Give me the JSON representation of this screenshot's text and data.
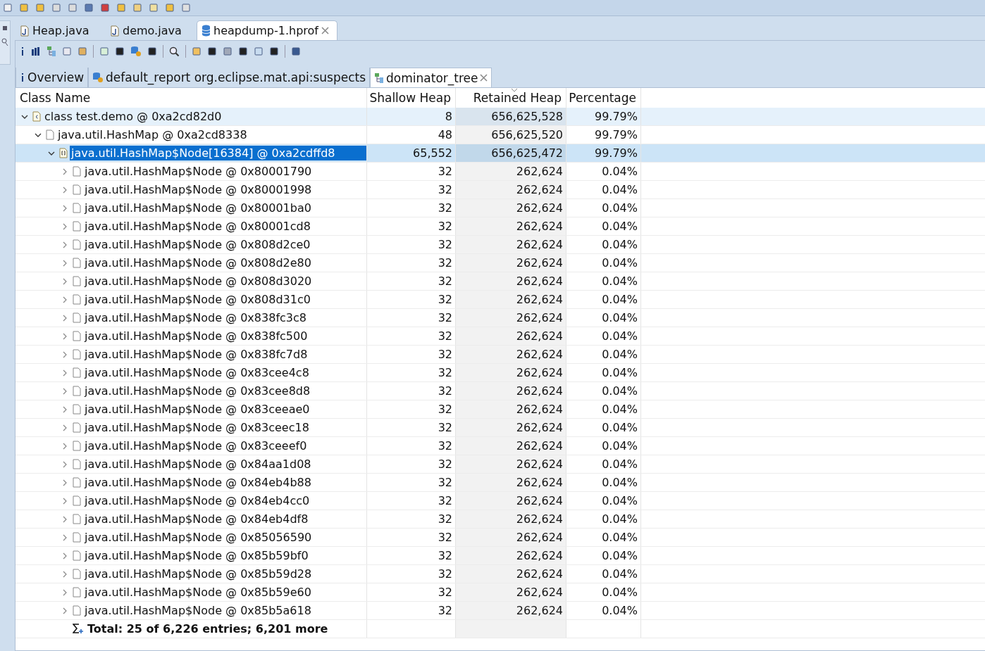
{
  "editor_tabs": [
    {
      "label": "Heap.java",
      "kind": "java",
      "selected": false,
      "closable": false
    },
    {
      "label": "demo.java",
      "kind": "java",
      "selected": false,
      "closable": false
    },
    {
      "label": "heapdump-1.hprof",
      "kind": "heap",
      "selected": true,
      "closable": true
    }
  ],
  "view_tabs": [
    {
      "label": "Overview",
      "kind": "info",
      "selected": false,
      "closable": false
    },
    {
      "label": "default_report  org.eclipse.mat.api:suspects",
      "kind": "report",
      "selected": false,
      "closable": false
    },
    {
      "label": "dominator_tree",
      "kind": "tree",
      "selected": true,
      "closable": true
    }
  ],
  "table": {
    "columns": [
      {
        "label": "Class Name",
        "sorted": false
      },
      {
        "label": "Shallow Heap",
        "sorted": false
      },
      {
        "label": "Retained Heap",
        "sorted": true
      },
      {
        "label": "Percentage",
        "sorted": false
      }
    ],
    "rows": [
      {
        "name": "class test.demo @ 0xa2cd82d0",
        "kind": "class",
        "shallow": "8",
        "retained": "656,625,528",
        "percentage": "99.79%",
        "expanded": true,
        "selected": false,
        "hovered": true,
        "children": [
          {
            "name": "java.util.HashMap @ 0xa2cd8338",
            "kind": "object",
            "shallow": "48",
            "retained": "656,625,520",
            "percentage": "99.79%",
            "expanded": true,
            "selected": false,
            "children": [
              {
                "name": "java.util.HashMap$Node[16384] @ 0xa2cdffd8",
                "kind": "array",
                "shallow": "65,552",
                "retained": "656,625,472",
                "percentage": "99.79%",
                "expanded": true,
                "selected": true,
                "children": [
                  {
                    "name": "java.util.HashMap$Node @ 0x80001790",
                    "kind": "object",
                    "shallow": "32",
                    "retained": "262,624",
                    "percentage": "0.04%",
                    "expanded": false,
                    "selected": false
                  },
                  {
                    "name": "java.util.HashMap$Node @ 0x80001998",
                    "kind": "object",
                    "shallow": "32",
                    "retained": "262,624",
                    "percentage": "0.04%",
                    "expanded": false,
                    "selected": false
                  },
                  {
                    "name": "java.util.HashMap$Node @ 0x80001ba0",
                    "kind": "object",
                    "shallow": "32",
                    "retained": "262,624",
                    "percentage": "0.04%",
                    "expanded": false,
                    "selected": false
                  },
                  {
                    "name": "java.util.HashMap$Node @ 0x80001cd8",
                    "kind": "object",
                    "shallow": "32",
                    "retained": "262,624",
                    "percentage": "0.04%",
                    "expanded": false,
                    "selected": false
                  },
                  {
                    "name": "java.util.HashMap$Node @ 0x808d2ce0",
                    "kind": "object",
                    "shallow": "32",
                    "retained": "262,624",
                    "percentage": "0.04%",
                    "expanded": false,
                    "selected": false
                  },
                  {
                    "name": "java.util.HashMap$Node @ 0x808d2e80",
                    "kind": "object",
                    "shallow": "32",
                    "retained": "262,624",
                    "percentage": "0.04%",
                    "expanded": false,
                    "selected": false
                  },
                  {
                    "name": "java.util.HashMap$Node @ 0x808d3020",
                    "kind": "object",
                    "shallow": "32",
                    "retained": "262,624",
                    "percentage": "0.04%",
                    "expanded": false,
                    "selected": false
                  },
                  {
                    "name": "java.util.HashMap$Node @ 0x808d31c0",
                    "kind": "object",
                    "shallow": "32",
                    "retained": "262,624",
                    "percentage": "0.04%",
                    "expanded": false,
                    "selected": false
                  },
                  {
                    "name": "java.util.HashMap$Node @ 0x838fc3c8",
                    "kind": "object",
                    "shallow": "32",
                    "retained": "262,624",
                    "percentage": "0.04%",
                    "expanded": false,
                    "selected": false
                  },
                  {
                    "name": "java.util.HashMap$Node @ 0x838fc500",
                    "kind": "object",
                    "shallow": "32",
                    "retained": "262,624",
                    "percentage": "0.04%",
                    "expanded": false,
                    "selected": false
                  },
                  {
                    "name": "java.util.HashMap$Node @ 0x838fc7d8",
                    "kind": "object",
                    "shallow": "32",
                    "retained": "262,624",
                    "percentage": "0.04%",
                    "expanded": false,
                    "selected": false
                  },
                  {
                    "name": "java.util.HashMap$Node @ 0x83cee4c8",
                    "kind": "object",
                    "shallow": "32",
                    "retained": "262,624",
                    "percentage": "0.04%",
                    "expanded": false,
                    "selected": false
                  },
                  {
                    "name": "java.util.HashMap$Node @ 0x83cee8d8",
                    "kind": "object",
                    "shallow": "32",
                    "retained": "262,624",
                    "percentage": "0.04%",
                    "expanded": false,
                    "selected": false
                  },
                  {
                    "name": "java.util.HashMap$Node @ 0x83ceeae0",
                    "kind": "object",
                    "shallow": "32",
                    "retained": "262,624",
                    "percentage": "0.04%",
                    "expanded": false,
                    "selected": false
                  },
                  {
                    "name": "java.util.HashMap$Node @ 0x83ceec18",
                    "kind": "object",
                    "shallow": "32",
                    "retained": "262,624",
                    "percentage": "0.04%",
                    "expanded": false,
                    "selected": false
                  },
                  {
                    "name": "java.util.HashMap$Node @ 0x83ceeef0",
                    "kind": "object",
                    "shallow": "32",
                    "retained": "262,624",
                    "percentage": "0.04%",
                    "expanded": false,
                    "selected": false
                  },
                  {
                    "name": "java.util.HashMap$Node @ 0x84aa1d08",
                    "kind": "object",
                    "shallow": "32",
                    "retained": "262,624",
                    "percentage": "0.04%",
                    "expanded": false,
                    "selected": false
                  },
                  {
                    "name": "java.util.HashMap$Node @ 0x84eb4b88",
                    "kind": "object",
                    "shallow": "32",
                    "retained": "262,624",
                    "percentage": "0.04%",
                    "expanded": false,
                    "selected": false
                  },
                  {
                    "name": "java.util.HashMap$Node @ 0x84eb4cc0",
                    "kind": "object",
                    "shallow": "32",
                    "retained": "262,624",
                    "percentage": "0.04%",
                    "expanded": false,
                    "selected": false
                  },
                  {
                    "name": "java.util.HashMap$Node @ 0x84eb4df8",
                    "kind": "object",
                    "shallow": "32",
                    "retained": "262,624",
                    "percentage": "0.04%",
                    "expanded": false,
                    "selected": false
                  },
                  {
                    "name": "java.util.HashMap$Node @ 0x85056590",
                    "kind": "object",
                    "shallow": "32",
                    "retained": "262,624",
                    "percentage": "0.04%",
                    "expanded": false,
                    "selected": false
                  },
                  {
                    "name": "java.util.HashMap$Node @ 0x85b59bf0",
                    "kind": "object",
                    "shallow": "32",
                    "retained": "262,624",
                    "percentage": "0.04%",
                    "expanded": false,
                    "selected": false
                  },
                  {
                    "name": "java.util.HashMap$Node @ 0x85b59d28",
                    "kind": "object",
                    "shallow": "32",
                    "retained": "262,624",
                    "percentage": "0.04%",
                    "expanded": false,
                    "selected": false
                  },
                  {
                    "name": "java.util.HashMap$Node @ 0x85b59e60",
                    "kind": "object",
                    "shallow": "32",
                    "retained": "262,624",
                    "percentage": "0.04%",
                    "expanded": false,
                    "selected": false
                  },
                  {
                    "name": "java.util.HashMap$Node @ 0x85b5a618",
                    "kind": "object",
                    "shallow": "32",
                    "retained": "262,624",
                    "percentage": "0.04%",
                    "expanded": false,
                    "selected": false
                  },
                  {
                    "name": "Total: 25 of 6,226 entries; 6,201 more",
                    "kind": "total"
                  }
                ]
              }
            ]
          }
        ]
      }
    ]
  }
}
